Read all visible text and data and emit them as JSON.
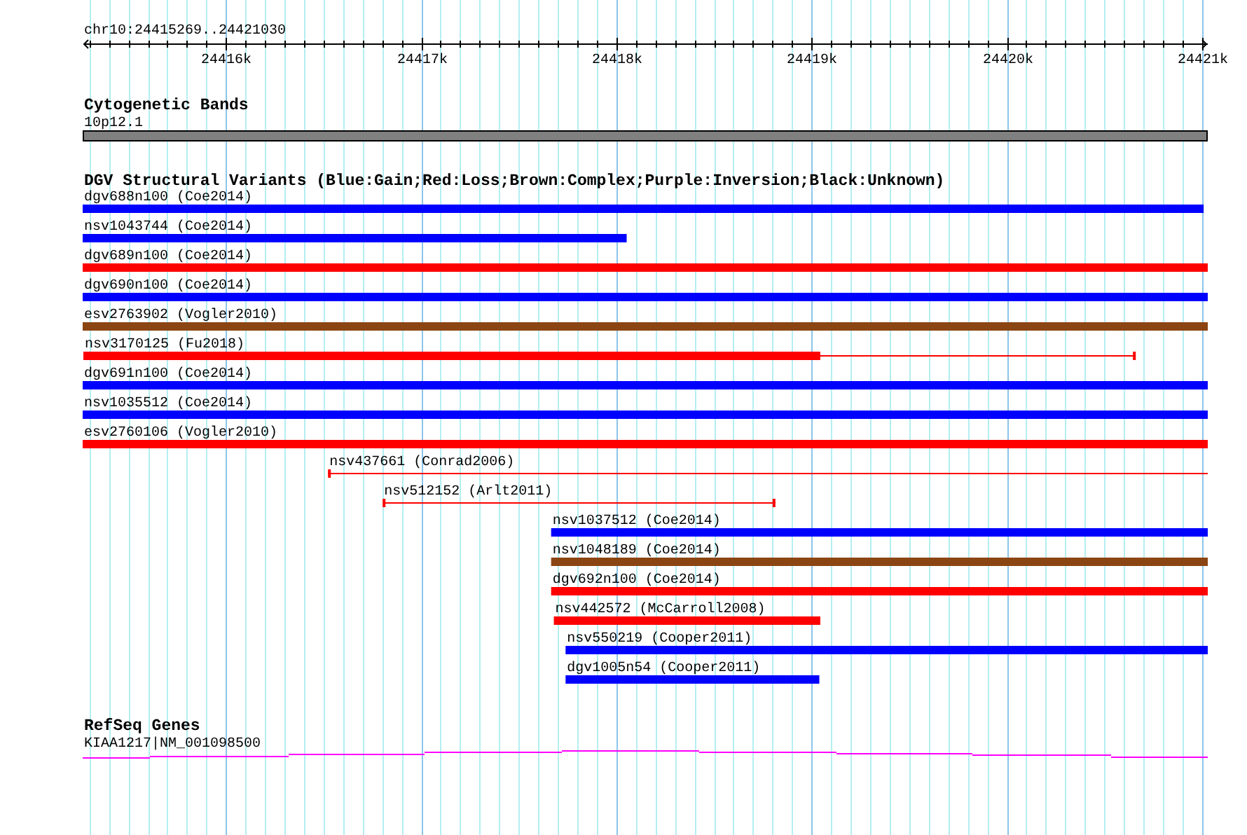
{
  "ruler": {
    "location": "chr10:24415269..24421030",
    "tick_labels": [
      "24416k",
      "24417k",
      "24418k",
      "24419k",
      "24420k",
      "24421k"
    ]
  },
  "cytoband_track": {
    "title": "Cytogenetic Bands",
    "band": "10p12.1"
  },
  "variant_track": {
    "title": "DGV Structural Variants (Blue:Gain;Red:Loss;Brown:Complex;Purple:Inversion;Black:Unknown)",
    "variants": [
      {
        "label": "dgv688n100 (Coe2014)",
        "color": "#0000ff",
        "kind": "solid"
      },
      {
        "label": "nsv1043744 (Coe2014)",
        "color": "#0000ff",
        "kind": "solid"
      },
      {
        "label": "dgv689n100 (Coe2014)",
        "color": "#ff0000",
        "kind": "solid"
      },
      {
        "label": "dgv690n100 (Coe2014)",
        "color": "#0000ff",
        "kind": "solid"
      },
      {
        "label": "esv2763902 (Vogler2010)",
        "color": "#8b4513",
        "kind": "solid"
      },
      {
        "label": "nsv3170125 (Fu2018)",
        "color": "#ff0000",
        "kind": "mixed"
      },
      {
        "label": "dgv691n100 (Coe2014)",
        "color": "#0000ff",
        "kind": "solid"
      },
      {
        "label": "nsv1035512 (Coe2014)",
        "color": "#0000ff",
        "kind": "solid"
      },
      {
        "label": "esv2760106 (Vogler2010)",
        "color": "#ff0000",
        "kind": "solid"
      },
      {
        "label": "nsv437661 (Conrad2006)",
        "color": "#ff0000",
        "kind": "line"
      },
      {
        "label": "nsv512152 (Arlt2011)",
        "color": "#ff0000",
        "kind": "line"
      },
      {
        "label": "nsv1037512 (Coe2014)",
        "color": "#0000ff",
        "kind": "solid"
      },
      {
        "label": "nsv1048189 (Coe2014)",
        "color": "#8b4513",
        "kind": "solid"
      },
      {
        "label": "dgv692n100 (Coe2014)",
        "color": "#ff0000",
        "kind": "solid"
      },
      {
        "label": "nsv442572 (McCarroll2008)",
        "color": "#ff0000",
        "kind": "solid"
      },
      {
        "label": "nsv550219 (Cooper2011)",
        "color": "#0000ff",
        "kind": "solid"
      },
      {
        "label": "dgv1005n54 (Cooper2011)",
        "color": "#0000ff",
        "kind": "solid"
      }
    ]
  },
  "gene_track": {
    "title": "RefSeq Genes",
    "gene": "KIAA1217|NM_001098500"
  }
}
